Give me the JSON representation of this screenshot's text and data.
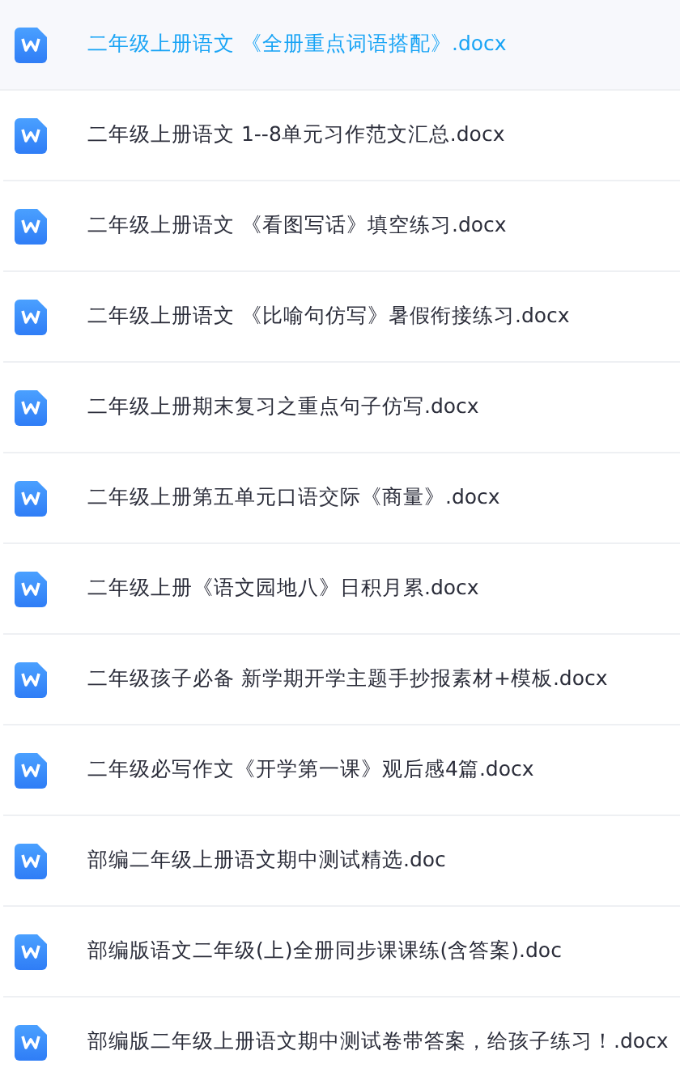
{
  "files": [
    {
      "name": "二年级上册语文 《全册重点词语搭配》.docx",
      "selected": true
    },
    {
      "name": "二年级上册语文 1--8单元习作范文汇总.docx",
      "selected": false
    },
    {
      "name": "二年级上册语文 《看图写话》填空练习.docx",
      "selected": false
    },
    {
      "name": "二年级上册语文 《比喻句仿写》暑假衔接练习.docx",
      "selected": false
    },
    {
      "name": "二年级上册期末复习之重点句子仿写.docx",
      "selected": false
    },
    {
      "name": "二年级上册第五单元口语交际《商量》.docx",
      "selected": false
    },
    {
      "name": "二年级上册《语文园地八》日积月累.docx",
      "selected": false
    },
    {
      "name": "二年级孩子必备 新学期开学主题手抄报素材+模板.docx",
      "selected": false
    },
    {
      "name": "二年级必写作文《开学第一课》观后感4篇.docx",
      "selected": false
    },
    {
      "name": "部编二年级上册语文期中测试精选.doc",
      "selected": false
    },
    {
      "name": "部编版语文二年级(上)全册同步课课练(含答案).doc",
      "selected": false
    },
    {
      "name": "部编版二年级上册语文期中测试卷带答案，给孩子练习！.docx",
      "selected": false
    }
  ]
}
